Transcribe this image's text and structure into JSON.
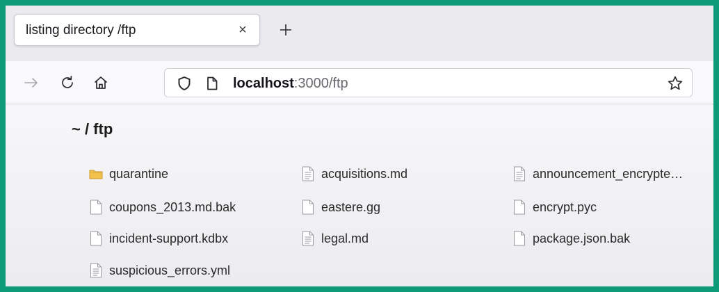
{
  "tab": {
    "title": "listing directory /ftp",
    "close_glyph": "×",
    "new_tab_glyph": "+"
  },
  "nav": {
    "back_icon": "back-arrow-icon",
    "reload_icon": "reload-icon",
    "home_icon": "home-icon"
  },
  "urlbar": {
    "host": "localhost",
    "rest": ":3000/ftp",
    "shield_icon": "tracking-shield-icon",
    "page_icon": "page-icon",
    "bookmark_icon": "star-icon"
  },
  "page": {
    "title": "~ / ftp",
    "files": [
      {
        "name": "quarantine",
        "icon": "folder"
      },
      {
        "name": "acquisitions.md",
        "icon": "text-file"
      },
      {
        "name": "announcement_encrypte…",
        "icon": "text-file"
      },
      {
        "name": "coupons_2013.md.bak",
        "icon": "blank-file"
      },
      {
        "name": "eastere.gg",
        "icon": "blank-file"
      },
      {
        "name": "encrypt.pyc",
        "icon": "blank-file"
      },
      {
        "name": "incident-support.kdbx",
        "icon": "blank-file"
      },
      {
        "name": "legal.md",
        "icon": "text-file"
      },
      {
        "name": "package.json.bak",
        "icon": "blank-file"
      },
      {
        "name": "suspicious_errors.yml",
        "icon": "text-file"
      }
    ]
  },
  "colors": {
    "frame": "#0c9a78",
    "folder": "#f2c14e"
  }
}
